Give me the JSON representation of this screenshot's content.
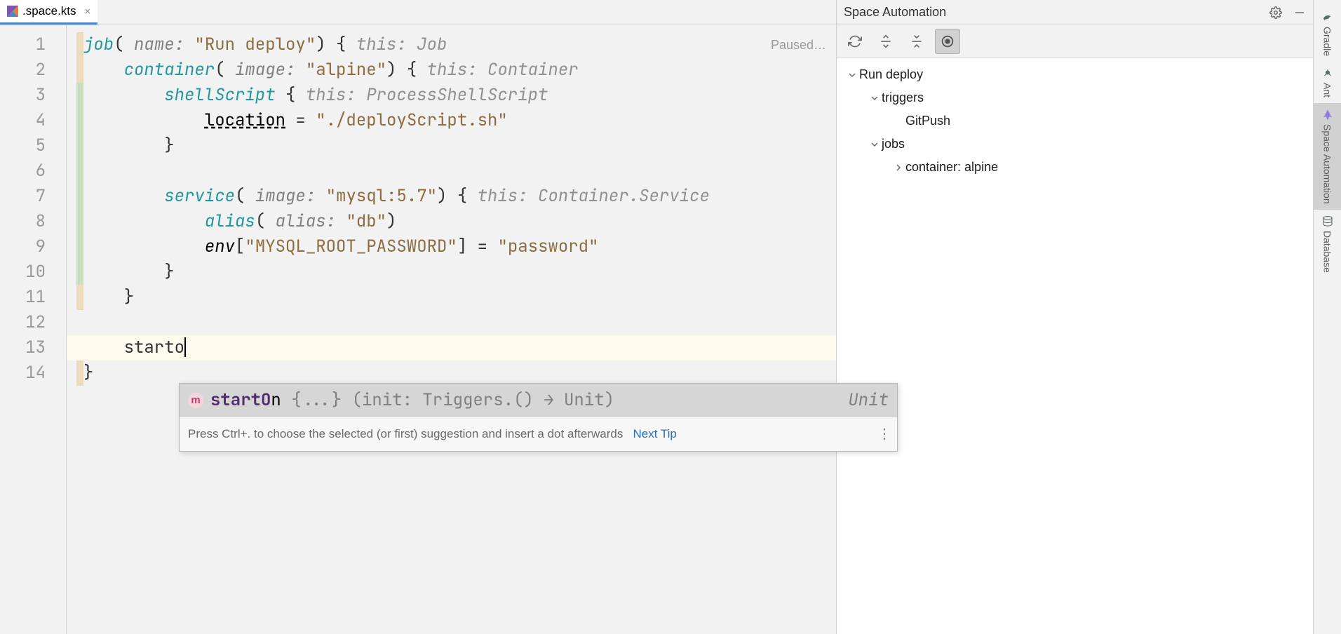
{
  "tab": {
    "filename": ".space.kts"
  },
  "editor": {
    "status": "Paused…",
    "lines": [
      "1",
      "2",
      "3",
      "4",
      "5",
      "6",
      "7",
      "8",
      "9",
      "10",
      "11",
      "12",
      "13",
      "14"
    ],
    "code": {
      "job_kw": "job",
      "name_param": "name:",
      "job_name": "\"Run deploy\"",
      "job_hint": "this: Job",
      "container_kw": "container",
      "image_param": "image:",
      "container_image": "\"alpine\"",
      "container_hint": "this: Container",
      "shell_kw": "shellScript",
      "shell_hint": "this: ProcessShellScript",
      "location_kw": "location",
      "location_val": "\"./deployScript.sh\"",
      "service_kw": "service",
      "service_image": "\"mysql:5.7\"",
      "service_hint": "this: Container.Service",
      "alias_kw": "alias",
      "alias_param": "alias:",
      "alias_val": "\"db\"",
      "env_var": "env",
      "env_key": "\"MYSQL_ROOT_PASSWORD\"",
      "env_val": "\"password\"",
      "typed": "starto"
    }
  },
  "completion": {
    "icon_letter": "m",
    "name_bold": "startO",
    "name_rest": "n",
    "signature": " {...} (init: Triggers.() → Unit)",
    "return_type": "Unit",
    "hint": "Press Ctrl+. to choose the selected (or first) suggestion and insert a dot afterwards",
    "next_tip": "Next Tip"
  },
  "panel": {
    "title": "Space Automation",
    "tree": {
      "root": "Run deploy",
      "triggers_label": "triggers",
      "trigger_item": "GitPush",
      "jobs_label": "jobs",
      "job_item": "container: alpine"
    }
  },
  "sidebar": {
    "items": [
      {
        "label": "Gradle"
      },
      {
        "label": "Ant"
      },
      {
        "label": "Space Automation"
      },
      {
        "label": "Database"
      }
    ]
  }
}
